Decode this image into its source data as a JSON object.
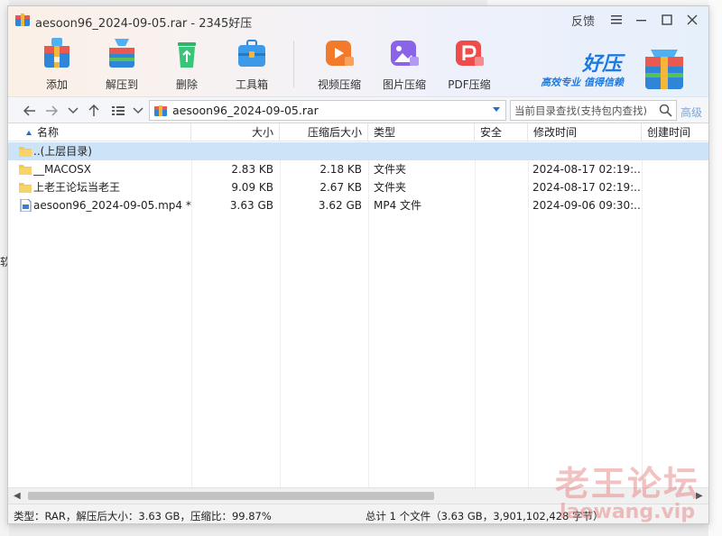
{
  "window": {
    "title": "aesoon96_2024-09-05.rar - 2345好压",
    "feedback": "反馈"
  },
  "toolbar": {
    "items": [
      {
        "label": "添加",
        "icon": "add-box-icon"
      },
      {
        "label": "解压到",
        "icon": "extract-box-icon"
      },
      {
        "label": "删除",
        "icon": "recycle-icon"
      },
      {
        "label": "工具箱",
        "icon": "toolbox-icon"
      },
      {
        "label": "视频压缩",
        "icon": "video-compress-icon"
      },
      {
        "label": "图片压缩",
        "icon": "image-compress-icon"
      },
      {
        "label": "PDF压缩",
        "icon": "pdf-compress-icon"
      }
    ]
  },
  "brand": {
    "name": "好压",
    "slogan": "高效专业 值得信赖"
  },
  "address": {
    "path": "aesoon96_2024-09-05.rar",
    "search_placeholder": "当前目录查找(支持包内查找)",
    "advanced": "高级"
  },
  "columns": {
    "name": "名称",
    "size": "大小",
    "packed": "压缩后大小",
    "type": "类型",
    "security": "安全",
    "modified": "修改时间",
    "created": "创建时间"
  },
  "rows": [
    {
      "name": "..(上层目录)",
      "size": "",
      "packed": "",
      "type": "",
      "modified": "",
      "icon": "folder-icon"
    },
    {
      "name": "__MACOSX",
      "size": "2.83 KB",
      "packed": "2.18 KB",
      "type": "文件夹",
      "modified": "2024-08-17 02:19:...",
      "icon": "folder-icon"
    },
    {
      "name": "上老王论坛当老王",
      "size": "9.09 KB",
      "packed": "2.67 KB",
      "type": "文件夹",
      "modified": "2024-08-17 02:19:...",
      "icon": "folder-icon"
    },
    {
      "name": "aesoon96_2024-09-05.mp4 *",
      "size": "3.63 GB",
      "packed": "3.62 GB",
      "type": "MP4 文件",
      "modified": "2024-09-06 09:30:...",
      "icon": "video-file-icon"
    }
  ],
  "status": {
    "left": "类型：RAR，解压后大小：3.63 GB，压缩比：99.87%",
    "right": "总计 1 个文件（3.63 GB，3,901,102,428 字节）"
  },
  "watermark": {
    "text": "老王论坛",
    "url": "laowang.vip"
  },
  "background": {
    "edge_text": "软"
  },
  "colors": {
    "accent": "#1a6fd6",
    "selected_row": "#cde3f7",
    "brand_blue": "#1d7be0"
  }
}
